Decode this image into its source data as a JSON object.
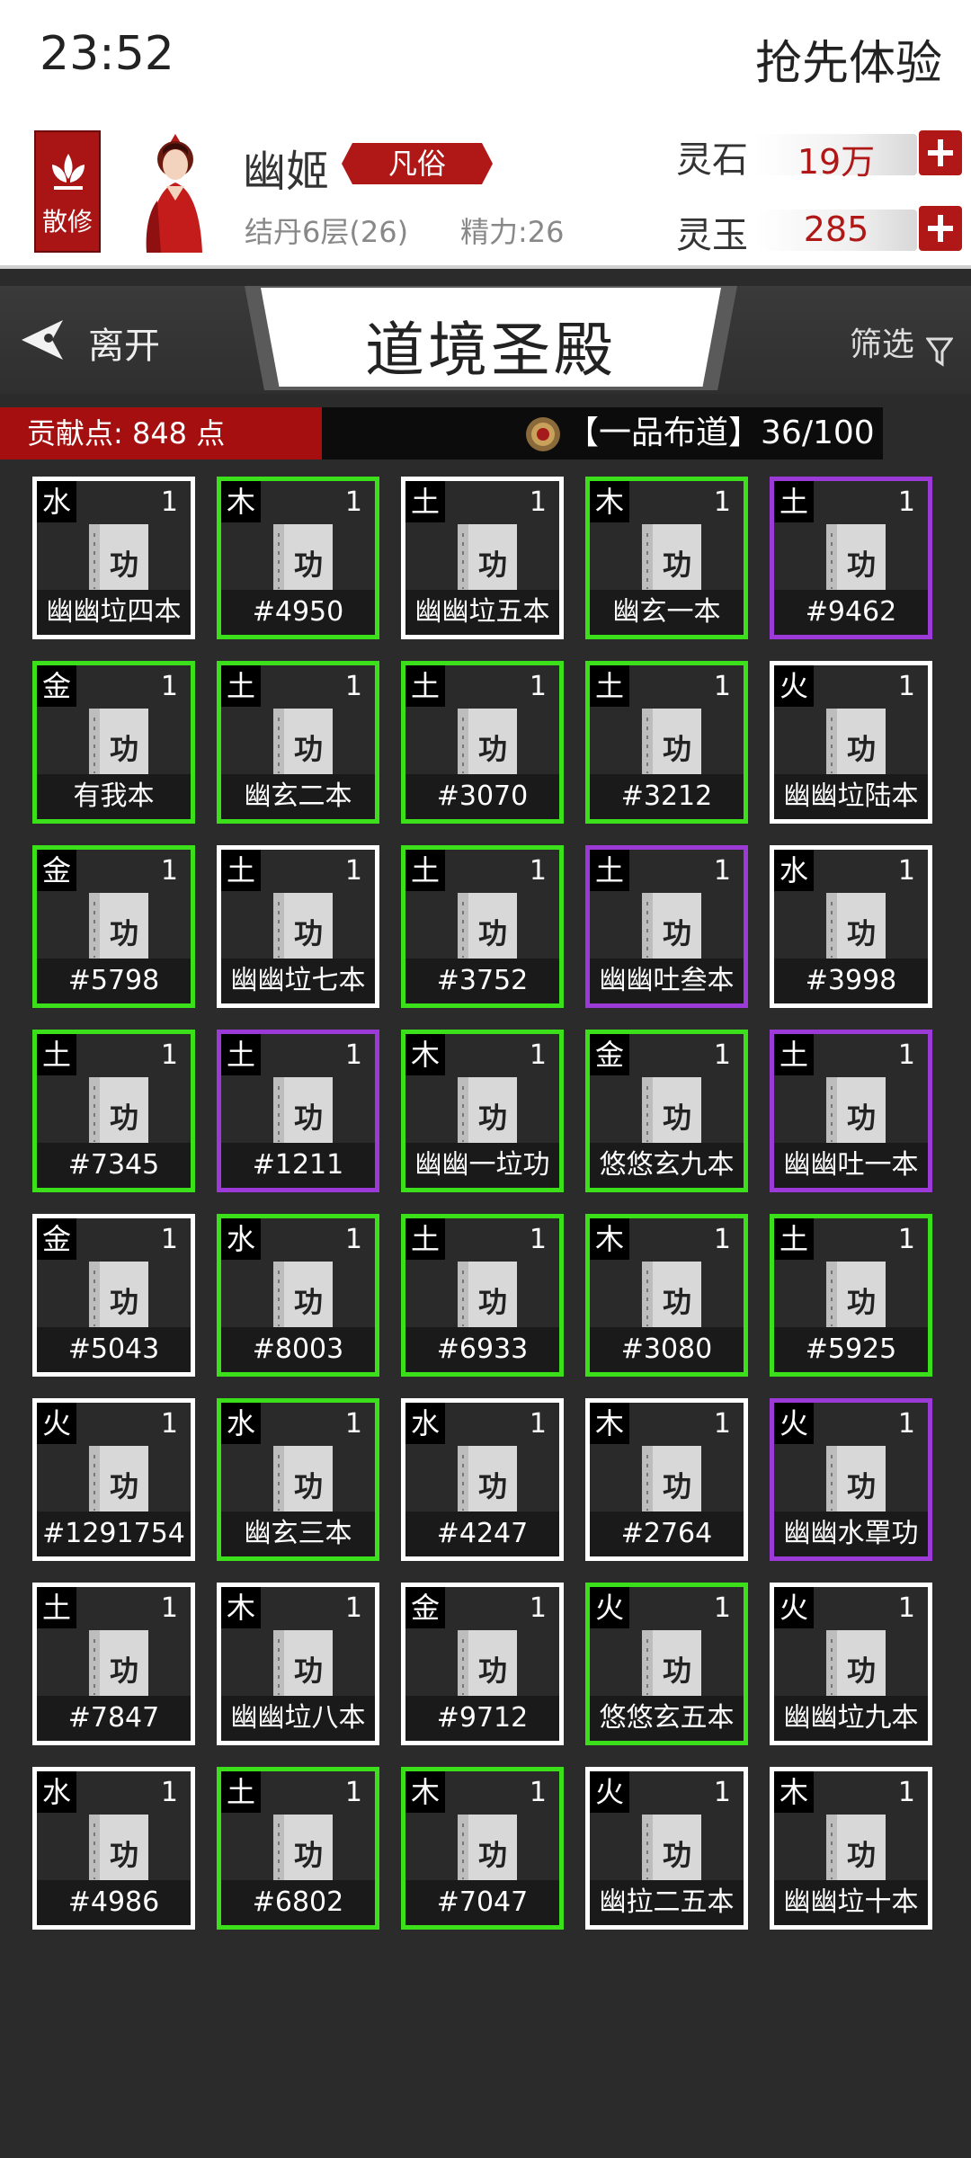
{
  "status_bar": {
    "time": "23:52",
    "right_text": "抢先体验"
  },
  "profile": {
    "sect_label": "散修",
    "name": "幽姬",
    "rank": "凡俗",
    "realm": "结丹6层(26)",
    "energy": "精力:26",
    "spirit_stone": {
      "label": "灵石",
      "value": "19万"
    },
    "spirit_jade": {
      "label": "灵玉",
      "value": "285"
    }
  },
  "nav": {
    "leave_label": "离开",
    "title": "道境圣殿",
    "filter_label": "筛选"
  },
  "contribution": {
    "text": "贡献点: 848 点"
  },
  "progress": {
    "title": "【一品布道】",
    "value": "36/100"
  },
  "colors": {
    "green": "#3be01b",
    "purple": "#9b3ad6",
    "white": "#ffffff",
    "accent_red": "#b01818"
  },
  "cards": [
    {
      "element": "水",
      "count": "1",
      "name": "幽幽垃四本",
      "rarity": "white"
    },
    {
      "element": "木",
      "count": "1",
      "name": "#4950",
      "rarity": "green"
    },
    {
      "element": "土",
      "count": "1",
      "name": "幽幽垃五本",
      "rarity": "white"
    },
    {
      "element": "木",
      "count": "1",
      "name": "幽玄一本",
      "rarity": "green"
    },
    {
      "element": "土",
      "count": "1",
      "name": "#9462",
      "rarity": "purple"
    },
    {
      "element": "金",
      "count": "1",
      "name": "有我本",
      "rarity": "green"
    },
    {
      "element": "土",
      "count": "1",
      "name": "幽玄二本",
      "rarity": "green"
    },
    {
      "element": "土",
      "count": "1",
      "name": "#3070",
      "rarity": "green"
    },
    {
      "element": "土",
      "count": "1",
      "name": "#3212",
      "rarity": "green"
    },
    {
      "element": "火",
      "count": "1",
      "name": "幽幽垃陆本",
      "rarity": "white"
    },
    {
      "element": "金",
      "count": "1",
      "name": "#5798",
      "rarity": "green"
    },
    {
      "element": "土",
      "count": "1",
      "name": "幽幽垃七本",
      "rarity": "white"
    },
    {
      "element": "土",
      "count": "1",
      "name": "#3752",
      "rarity": "green"
    },
    {
      "element": "土",
      "count": "1",
      "name": "幽幽吐叁本",
      "rarity": "purple"
    },
    {
      "element": "水",
      "count": "1",
      "name": "#3998",
      "rarity": "white"
    },
    {
      "element": "土",
      "count": "1",
      "name": "#7345",
      "rarity": "green"
    },
    {
      "element": "土",
      "count": "1",
      "name": "#1211",
      "rarity": "purple"
    },
    {
      "element": "木",
      "count": "1",
      "name": "幽幽一垃功",
      "rarity": "green"
    },
    {
      "element": "金",
      "count": "1",
      "name": "悠悠玄九本",
      "rarity": "green"
    },
    {
      "element": "土",
      "count": "1",
      "name": "幽幽吐一本",
      "rarity": "purple"
    },
    {
      "element": "金",
      "count": "1",
      "name": "#5043",
      "rarity": "white"
    },
    {
      "element": "水",
      "count": "1",
      "name": "#8003",
      "rarity": "green"
    },
    {
      "element": "土",
      "count": "1",
      "name": "#6933",
      "rarity": "green"
    },
    {
      "element": "木",
      "count": "1",
      "name": "#3080",
      "rarity": "green"
    },
    {
      "element": "土",
      "count": "1",
      "name": "#5925",
      "rarity": "green"
    },
    {
      "element": "火",
      "count": "1",
      "name": "#1291754",
      "rarity": "white"
    },
    {
      "element": "水",
      "count": "1",
      "name": "幽玄三本",
      "rarity": "green"
    },
    {
      "element": "水",
      "count": "1",
      "name": "#4247",
      "rarity": "white"
    },
    {
      "element": "木",
      "count": "1",
      "name": "#2764",
      "rarity": "white"
    },
    {
      "element": "火",
      "count": "1",
      "name": "幽幽水罩功",
      "rarity": "purple"
    },
    {
      "element": "土",
      "count": "1",
      "name": "#7847",
      "rarity": "white"
    },
    {
      "element": "木",
      "count": "1",
      "name": "幽幽垃八本",
      "rarity": "white"
    },
    {
      "element": "金",
      "count": "1",
      "name": "#9712",
      "rarity": "white"
    },
    {
      "element": "火",
      "count": "1",
      "name": "悠悠玄五本",
      "rarity": "green"
    },
    {
      "element": "火",
      "count": "1",
      "name": "幽幽垃九本",
      "rarity": "white"
    },
    {
      "element": "水",
      "count": "1",
      "name": "#4986",
      "rarity": "white"
    },
    {
      "element": "土",
      "count": "1",
      "name": "#6802",
      "rarity": "green"
    },
    {
      "element": "木",
      "count": "1",
      "name": "#7047",
      "rarity": "green"
    },
    {
      "element": "火",
      "count": "1",
      "name": "幽拉二五本",
      "rarity": "white"
    },
    {
      "element": "木",
      "count": "1",
      "name": "幽幽垃十本",
      "rarity": "white"
    }
  ],
  "book_glyph": "功"
}
